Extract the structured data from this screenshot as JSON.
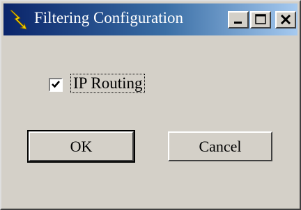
{
  "window": {
    "title": "Filtering Configuration",
    "icon": "lightning-bolt-icon",
    "controls": [
      "minimize-icon",
      "maximize-icon",
      "close-icon"
    ]
  },
  "form": {
    "ip_routing": {
      "label": "IP Routing",
      "checked": true
    }
  },
  "buttons": {
    "ok_label": "OK",
    "cancel_label": "Cancel"
  },
  "colors": {
    "titlebar_start": "#0a246a",
    "titlebar_end": "#a6caf0",
    "face": "#d4d0c8"
  }
}
